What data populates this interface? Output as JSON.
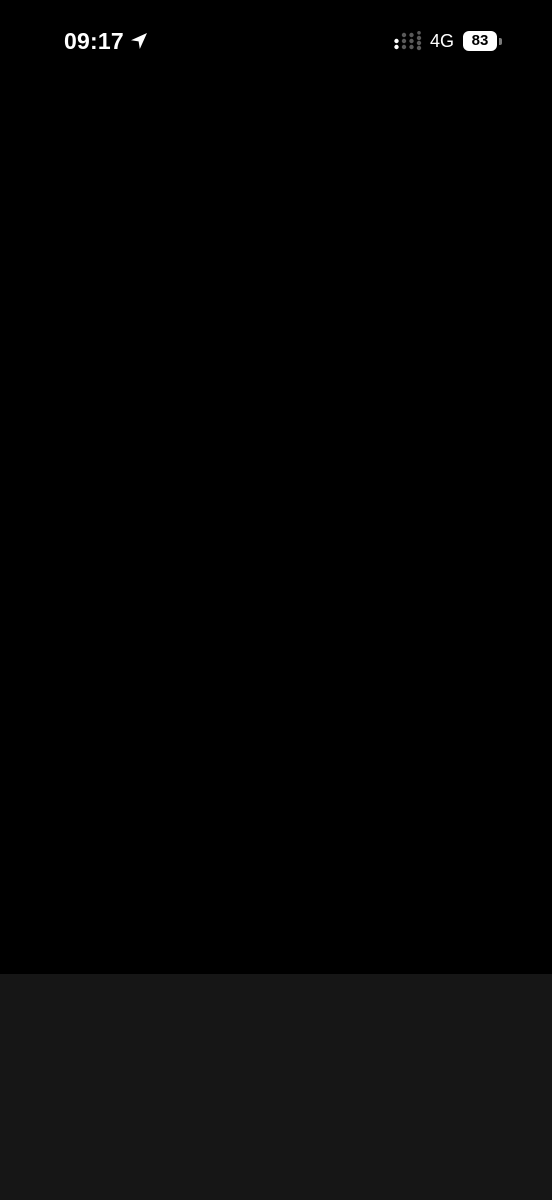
{
  "status_bar": {
    "time": "09:17",
    "network": "4G",
    "battery_level": "83",
    "battery_fraction": 0.83,
    "location_icon": "location-arrow-icon",
    "signal_icon": "cellular-signal-icon"
  },
  "colors": {
    "background": "#000000",
    "bottom_panel": "#161616",
    "foreground": "#ffffff"
  }
}
